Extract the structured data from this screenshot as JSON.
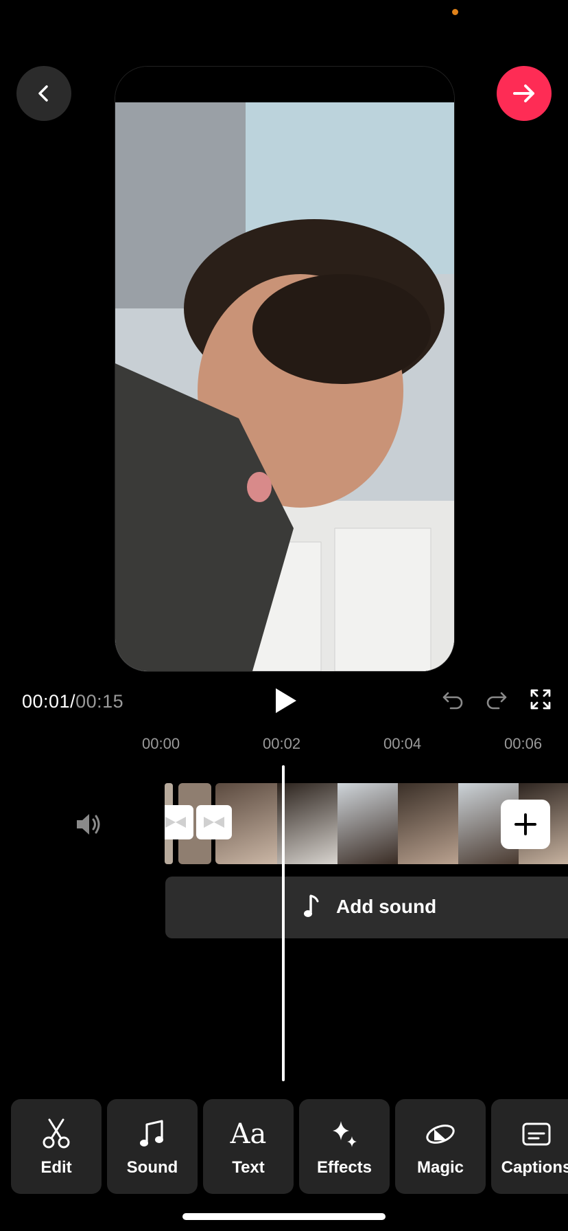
{
  "timecode": {
    "current": "00:01",
    "separator": "/",
    "total": "00:15"
  },
  "ruler": [
    "00:00",
    "00:02",
    "00:04",
    "00:06"
  ],
  "sound": {
    "add_label": "Add sound"
  },
  "toolbar": [
    {
      "label": "Edit",
      "icon": "scissors-icon"
    },
    {
      "label": "Sound",
      "icon": "music-note-icon"
    },
    {
      "label": "Text",
      "icon": "text-aa-icon"
    },
    {
      "label": "Effects",
      "icon": "sparkles-icon"
    },
    {
      "label": "Magic",
      "icon": "magic-icon"
    },
    {
      "label": "Captions",
      "icon": "captions-icon"
    }
  ],
  "colors": {
    "accent": "#fe2c55",
    "status_dot": "#e0821a",
    "panel": "#252525"
  }
}
